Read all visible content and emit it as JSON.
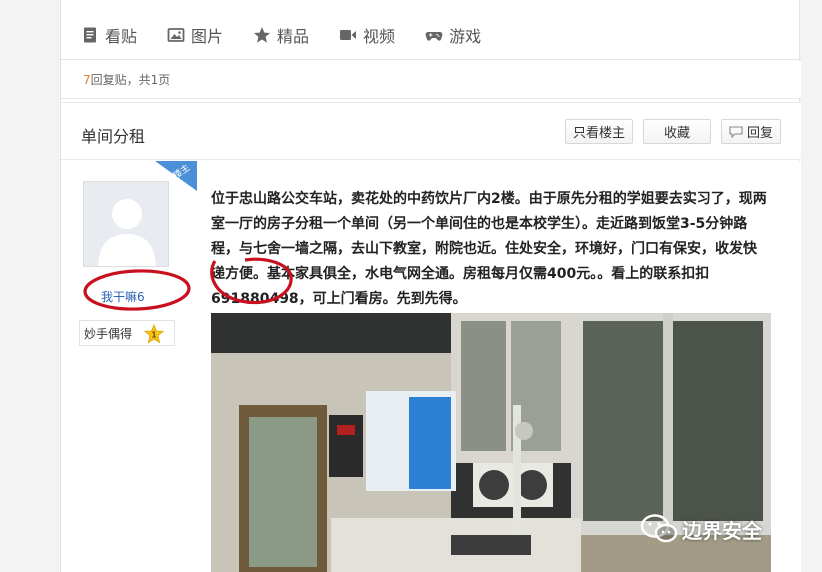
{
  "tabs": [
    {
      "label": "看贴",
      "icon": "document-icon"
    },
    {
      "label": "图片",
      "icon": "image-icon"
    },
    {
      "label": "精品",
      "icon": "star-icon"
    },
    {
      "label": "视频",
      "icon": "video-icon"
    },
    {
      "label": "游戏",
      "icon": "gamepad-icon"
    }
  ],
  "reply_count": {
    "count": "7",
    "text": "回复贴，共",
    "pages": "1",
    "pages_suffix": "页"
  },
  "thread": {
    "title": "单间分租"
  },
  "actions": {
    "only_op": "只看楼主",
    "favorite": "收藏",
    "reply": "回复"
  },
  "author": {
    "badge": "楼主",
    "name": "我干嘛6",
    "rank_title": "妙手偶得",
    "level": "1"
  },
  "post": {
    "body_lines": [
      "位于忠山路公交车站，卖花处的中药饮片厂内2楼。由于原先分租的学姐要去实习了，现两",
      "室一厅的房子分租一个单间（另一个单间住的也是本校学生）。走近路到饭堂3-5分钟路",
      "程，与七舍一墙之隔，去山下教室，附院也近。住处安全，环境好，门口有保安，收发快",
      "递方便。基本家具俱全，水电气网全通。房租每月仅需400元。。看上的联系扣扣",
      "691880498，可上门看房。先到先得。"
    ]
  },
  "watermark": {
    "text": "边界安全",
    "icon": "wechat-icon"
  },
  "colors": {
    "accent_orange": "#e67e22",
    "link_blue": "#2d64b3",
    "badge_blue": "#4a8fd8",
    "mark_red": "#c8101e"
  }
}
